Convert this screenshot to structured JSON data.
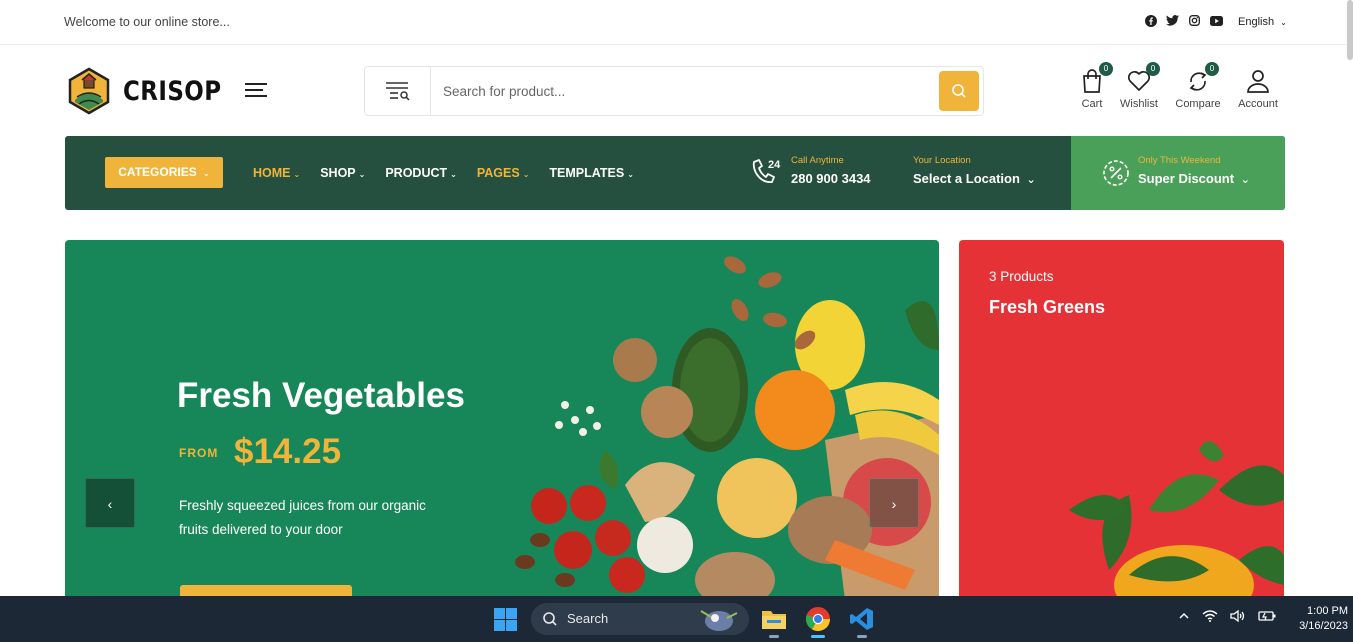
{
  "topbar": {
    "welcome": "Welcome to our online store...",
    "social": [
      "facebook-icon",
      "twitter-icon",
      "instagram-icon",
      "youtube-icon"
    ],
    "language": "English"
  },
  "header": {
    "brand": "CRISOP",
    "search_placeholder": "Search for product...",
    "actions": [
      {
        "label": "Cart",
        "badge": "0",
        "icon": "bag-icon"
      },
      {
        "label": "Wishlist",
        "badge": "0",
        "icon": "heart-icon"
      },
      {
        "label": "Compare",
        "badge": "0",
        "icon": "compare-icon"
      },
      {
        "label": "Account",
        "icon": "user-icon"
      }
    ]
  },
  "nav": {
    "categories_label": "CATEGORIES",
    "items": [
      {
        "label": "HOME",
        "active": true
      },
      {
        "label": "SHOP",
        "active": false
      },
      {
        "label": "PRODUCT",
        "active": false
      },
      {
        "label": "PAGES",
        "active": true
      },
      {
        "label": "TEMPLATES",
        "active": false
      }
    ],
    "call": {
      "small": "Call Anytime",
      "big": "280 900 3434",
      "icon_text": "24"
    },
    "location": {
      "small": "Your Location",
      "big": "Select a Location"
    },
    "discount": {
      "small": "Only This Weekend",
      "big": "Super Discount"
    }
  },
  "hero": {
    "title": "Fresh Vegetables",
    "from_label": "FROM",
    "price": "$14.25",
    "description": "Freshly squeezed juices from our organic fruits delivered to your door",
    "prev_glyph": "‹",
    "next_glyph": "›"
  },
  "promo": {
    "count": "3 Products",
    "title": "Fresh Greens"
  },
  "taskbar": {
    "search_label": "Search",
    "time": "1:00 PM",
    "date": "3/16/2023"
  },
  "colors": {
    "brand_dark": "#254f3e",
    "accent": "#f0b43a",
    "discount_green": "#4aa059",
    "hero_green": "#17875a",
    "promo_red": "#e53236"
  }
}
